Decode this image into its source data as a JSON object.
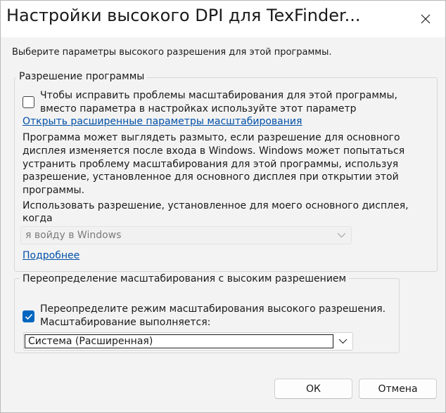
{
  "window": {
    "title": "Настройки высокого DPI для TexFinder...",
    "close_icon": "close-icon"
  },
  "intro": "Выберите параметры высокого разрешения для этой программы.",
  "program_dpi": {
    "legend": "Разрешение программы",
    "checkbox_checked": false,
    "checkbox_label_line1": "Чтобы исправить проблемы масштабирования для этой программы,",
    "checkbox_label_line2": "вместо параметра в настройках используйте этот параметр",
    "advanced_link": "Открыть расширенные параметры масштабирования",
    "description_lines": [
      "Программа может выглядеть размыто, если разрешение для основного",
      "дисплея изменяется после входа в Windows. Windows может попытаться",
      "устранить проблему масштабирования для этой программы, используя",
      "разрешение, установленное для основного дисплея при открытии этой",
      "программы."
    ],
    "use_dpi_line1": "Использовать разрешение, установленное для моего основного дисплея,",
    "use_dpi_line2": "когда",
    "select_value": "я войду в Windows",
    "learn_more_link": "Подробнее"
  },
  "override": {
    "legend": "Переопределение масштабирования с высоким разрешением",
    "checkbox_checked": true,
    "checkbox_label_line1": "Переопределите режим масштабирования высокого разрешения.",
    "checkbox_label_line2": "Масштабирование выполняется:",
    "select_value": "Система (Расширенная)"
  },
  "buttons": {
    "ok": "ОК",
    "cancel": "Отмена"
  },
  "colors": {
    "accent": "#0067c0",
    "link": "#0050a8"
  }
}
